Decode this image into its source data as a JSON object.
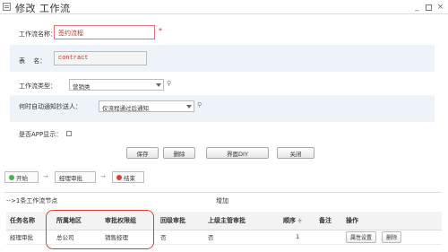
{
  "window": {
    "title": "修改 工作流",
    "min_glyph": "_",
    "close_glyph": "×"
  },
  "form": {
    "name_label": "工作流名称：",
    "name_value": "签约流程",
    "table_label": "表　  名：",
    "table_value": "contract",
    "type_label": "工作流类型：",
    "type_value": "营销类",
    "notify_label": "何时自动通知抄送人：",
    "notify_value": "仅流程通过后通知",
    "app_label": "是否APP显示：",
    "required_mark": "*"
  },
  "buttons": {
    "save": "保存",
    "delete": "删除",
    "diy": "界面DIY",
    "close": "关闭"
  },
  "flow": {
    "start": "开始",
    "step": "经理审批",
    "end": "结束",
    "start_color": "#4caf50",
    "end_color": "#e53935",
    "arrow": "→"
  },
  "steps": {
    "section_title": "-->1条工作流节点",
    "add_label": "增加",
    "columns": [
      "任务名称",
      "所属地区",
      "审批权限组",
      "回级审批",
      "上级主管审批",
      "顺序",
      "备注",
      "操作"
    ],
    "sort_glyph": "≑",
    "rows": [
      {
        "task": "经理审批",
        "region": "总公司",
        "group": "销售经理",
        "back": "否",
        "supervisor": "否",
        "order": "1",
        "note": "",
        "op_set": "属性设置",
        "op_del": "删除"
      }
    ]
  },
  "colors": {
    "highlight": "#e53935",
    "shade": "#eef3f9",
    "required": "#e02020"
  },
  "icons": [
    "window-icon",
    "lightbulb-icon",
    "dropdown-caret-icon",
    "checkbox-icon"
  ]
}
